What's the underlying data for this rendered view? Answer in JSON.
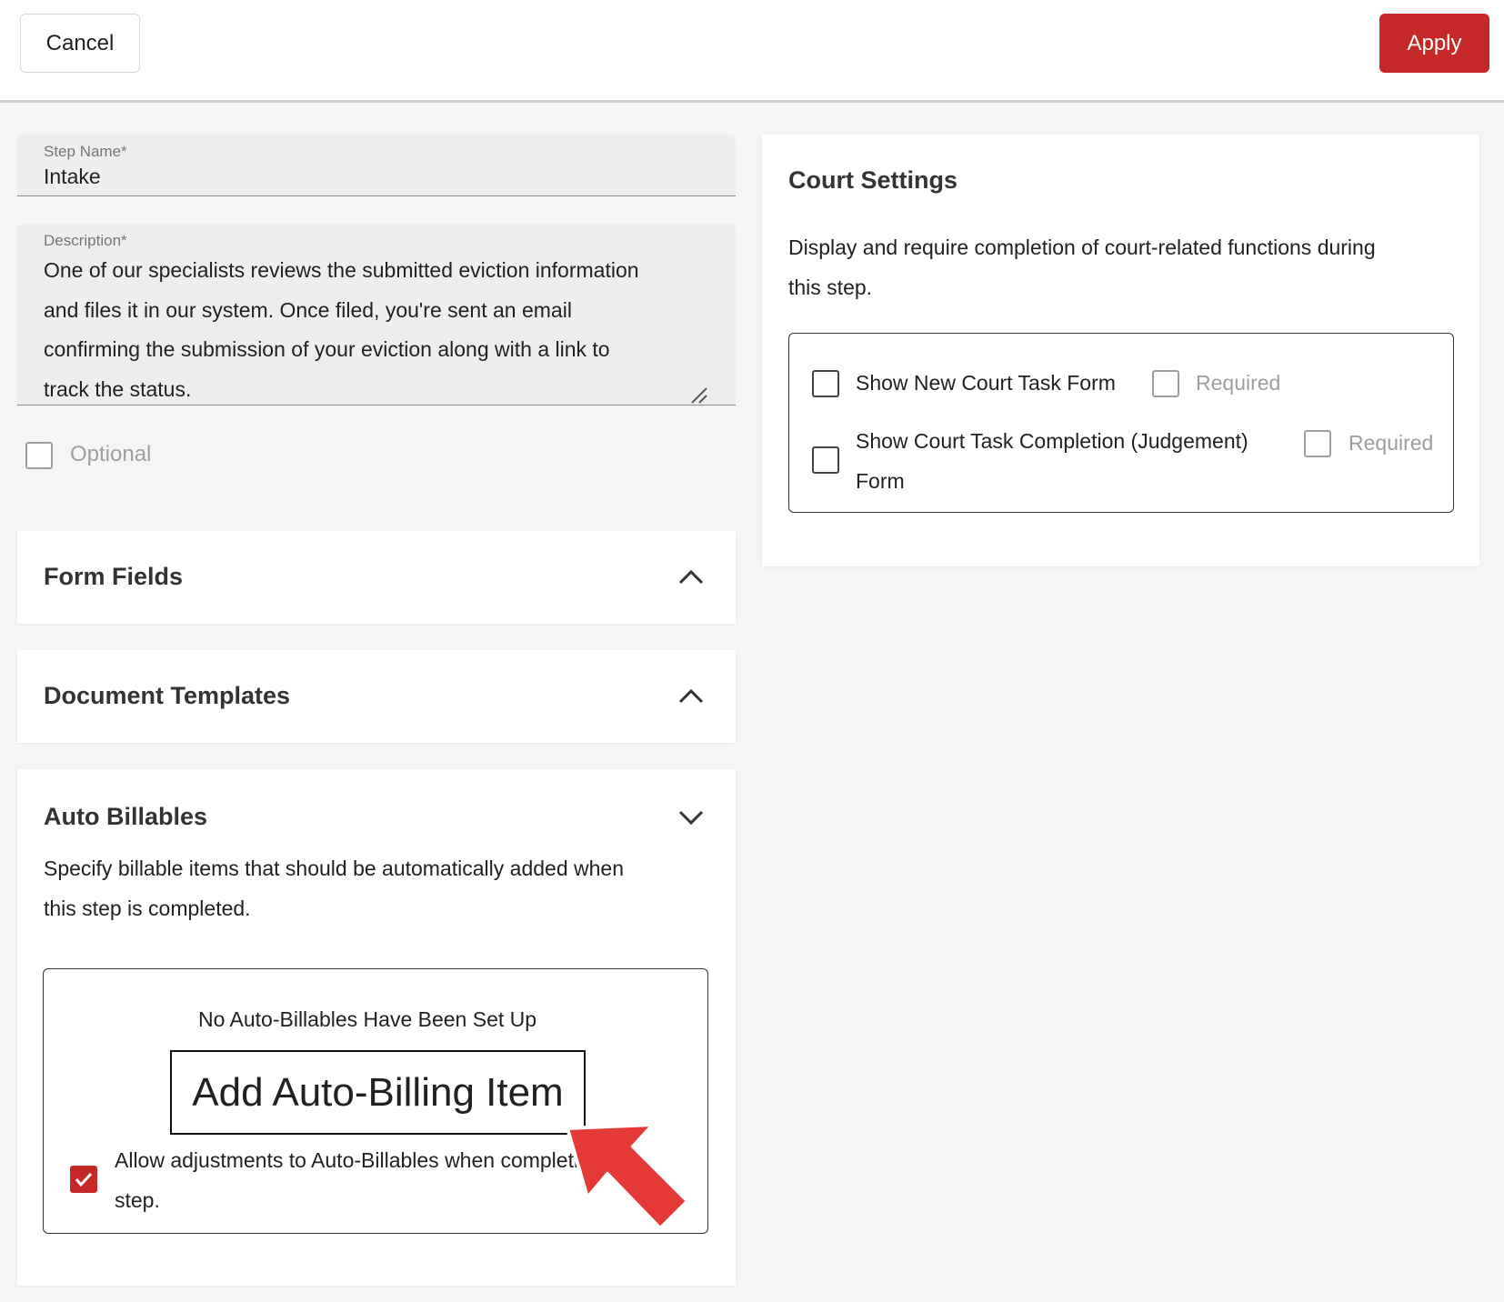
{
  "toolbar": {
    "cancel_label": "Cancel",
    "apply_label": "Apply",
    "accent_color": "#c62828"
  },
  "step_name": {
    "label": "Step Name*",
    "value": "Intake"
  },
  "description": {
    "label": "Description*",
    "lines": [
      "One of our specialists reviews the submitted eviction information",
      "and files it in our system. Once filed, you're sent an email",
      "confirming the submission of your eviction along with a link to",
      "track the status."
    ]
  },
  "optional": {
    "label": "Optional",
    "checked": false
  },
  "form_fields": {
    "title": "Form Fields",
    "expanded": false,
    "icon": "chevron-up-icon"
  },
  "document_templates": {
    "title": "Document Templates",
    "expanded": false,
    "icon": "chevron-up-icon"
  },
  "auto_billables": {
    "title": "Auto Billables",
    "expanded": true,
    "icon": "chevron-down-icon",
    "description_lines": [
      "Specify billable items that should be automatically added when",
      "this step is completed."
    ],
    "empty_text": "No Auto-Billables Have Been Set Up",
    "add_button_label": "Add Auto-Billing Item",
    "allow_adjust": {
      "lines": [
        "Allow adjustments to Auto-Billables when completing",
        "step."
      ],
      "checked": true
    }
  },
  "court_settings": {
    "title": "Court Settings",
    "description_lines": [
      "Display and require completion of court-related functions during",
      "this step."
    ],
    "options": [
      {
        "label_lines": [
          "Show New Court Task Form"
        ],
        "checked": false,
        "required_label": "Required",
        "required_checked": false
      },
      {
        "label_lines": [
          "Show Court Task Completion (Judgement)",
          "Form"
        ],
        "checked": false,
        "required_label": "Required",
        "required_checked": false
      }
    ]
  }
}
